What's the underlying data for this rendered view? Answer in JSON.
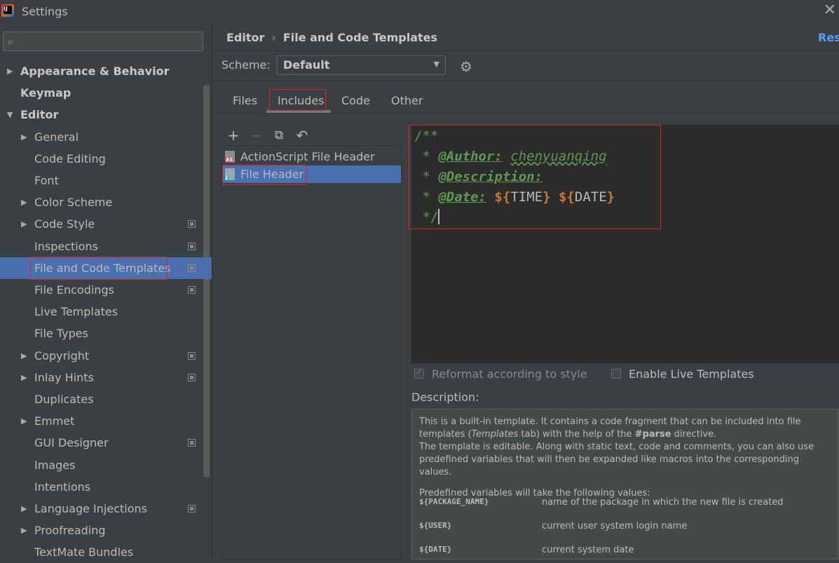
{
  "window": {
    "title": "Settings",
    "close_glyph": "✕"
  },
  "sidebar": {
    "search_placeholder": "",
    "items": [
      {
        "label": "Appearance & Behavior",
        "arrow": "▶",
        "bold": true
      },
      {
        "label": "Keymap",
        "bold": true
      },
      {
        "label": "Editor",
        "arrow": "▼",
        "bold": true
      },
      {
        "label": "General",
        "arrow": "▶"
      },
      {
        "label": "Code Editing"
      },
      {
        "label": "Font"
      },
      {
        "label": "Color Scheme",
        "arrow": "▶"
      },
      {
        "label": "Code Style",
        "arrow": "▶",
        "project_icon": true
      },
      {
        "label": "Inspections",
        "project_icon": true
      },
      {
        "label": "File and Code Templates",
        "project_icon": true,
        "selected": true
      },
      {
        "label": "File Encodings",
        "project_icon": true
      },
      {
        "label": "Live Templates"
      },
      {
        "label": "File Types"
      },
      {
        "label": "Copyright",
        "arrow": "▶",
        "project_icon": true
      },
      {
        "label": "Inlay Hints",
        "arrow": "▶",
        "project_icon": true
      },
      {
        "label": "Duplicates"
      },
      {
        "label": "Emmet",
        "arrow": "▶"
      },
      {
        "label": "GUI Designer",
        "project_icon": true
      },
      {
        "label": "Images"
      },
      {
        "label": "Intentions"
      },
      {
        "label": "Language Injections",
        "arrow": "▶",
        "project_icon": true
      },
      {
        "label": "Proofreading",
        "arrow": "▶"
      },
      {
        "label": "TextMate Bundles"
      }
    ]
  },
  "header": {
    "breadcrumb_root": "Editor",
    "breadcrumb_sep": "›",
    "breadcrumb_current": "File and Code Templates",
    "reset": "Rese"
  },
  "scheme": {
    "label": "Scheme:",
    "value": "Default",
    "dropdown_glyph": "▼",
    "gear_glyph": "⚙"
  },
  "tabs": [
    {
      "label": "Files"
    },
    {
      "label": "Includes",
      "active": true
    },
    {
      "label": "Code"
    },
    {
      "label": "Other"
    }
  ],
  "list": {
    "toolbar": {
      "add": "+",
      "remove": "−",
      "copy": "⧉",
      "reset": "↶"
    },
    "items": [
      {
        "name": "ActionScript File Header",
        "icon_tag": "AS"
      },
      {
        "name": "File Header",
        "icon_tag": "J",
        "selected": true
      }
    ]
  },
  "editor": {
    "line1": "/**",
    "line2_prefix": " * ",
    "author_tag": "@Author:",
    "author_value": "chenyuanqing",
    "line3_prefix": " * ",
    "description_tag": "@Description:",
    "line4_prefix": " * ",
    "date_tag": "@Date:",
    "time_dollar": "${",
    "time_var": "TIME",
    "time_close": "}",
    "date_dollar": "${",
    "date_var": "DATE",
    "date_close": "}",
    "line5": " */"
  },
  "options": {
    "reformat_label": "Reformat according to style",
    "reformat_checked": true,
    "live_templates_label": "Enable Live Templates",
    "live_templates_checked": false
  },
  "description": {
    "label": "Description:",
    "p1a": "This is a built-in template. It contains a code fragment that can be included into file templates (",
    "p1_templates": "Templates",
    "p1b": " tab) with the help of the ",
    "p1_parse": "#parse",
    "p1c": " directive.",
    "p2": "The template is editable. Along with static text, code and comments, you can also use predefined variables that will then be expanded like macros into the corresponding values.",
    "p3": "Predefined variables will take the following values:",
    "vars": [
      {
        "name": "${PACKAGE_NAME}",
        "desc": "name of the package in which the new file is created"
      },
      {
        "name": "${USER}",
        "desc": "current user system login name"
      },
      {
        "name": "${DATE}",
        "desc": "current system date"
      }
    ]
  },
  "colors": {
    "accent": "#4b6eaf",
    "highlight_box": "#d7262a",
    "link": "#589df6"
  }
}
